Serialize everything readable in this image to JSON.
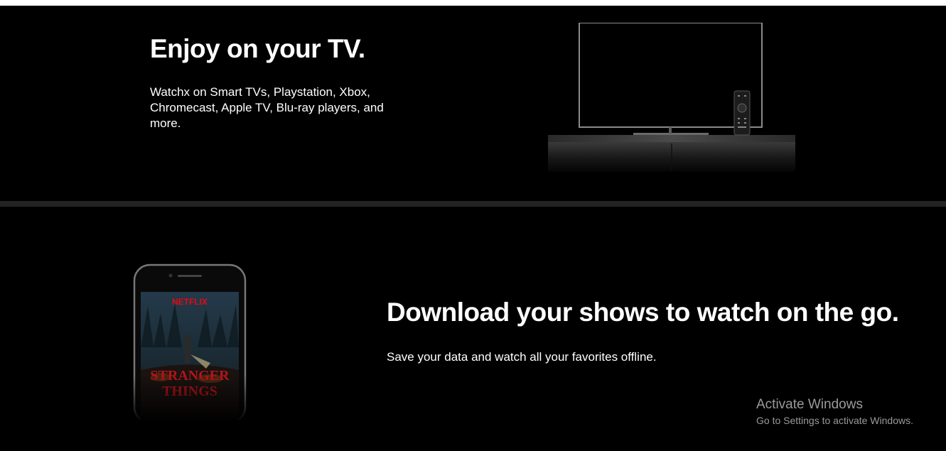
{
  "tv_section": {
    "title": "Enjoy on your TV.",
    "description": "Watchx on Smart TVs, Playstation, Xbox, Chromecast, Apple TV, Blu-ray players, and more."
  },
  "download_section": {
    "title": "Download your shows to watch on the go.",
    "description": "Save your data and watch all your favorites offline.",
    "poster_brand": "NETFLIX",
    "poster_title_line1": "STRANGER",
    "poster_title_line2": "THINGS"
  },
  "watermark": {
    "title": "Activate Windows",
    "subtitle": "Go to Settings to activate Windows."
  },
  "colors": {
    "background": "#000000",
    "divider": "#232323",
    "text": "#ffffff",
    "brand_red": "#e50914",
    "watermark": "#9a9a9a"
  },
  "icons": {
    "tv": "tv-illustration",
    "phone": "phone-illustration"
  }
}
